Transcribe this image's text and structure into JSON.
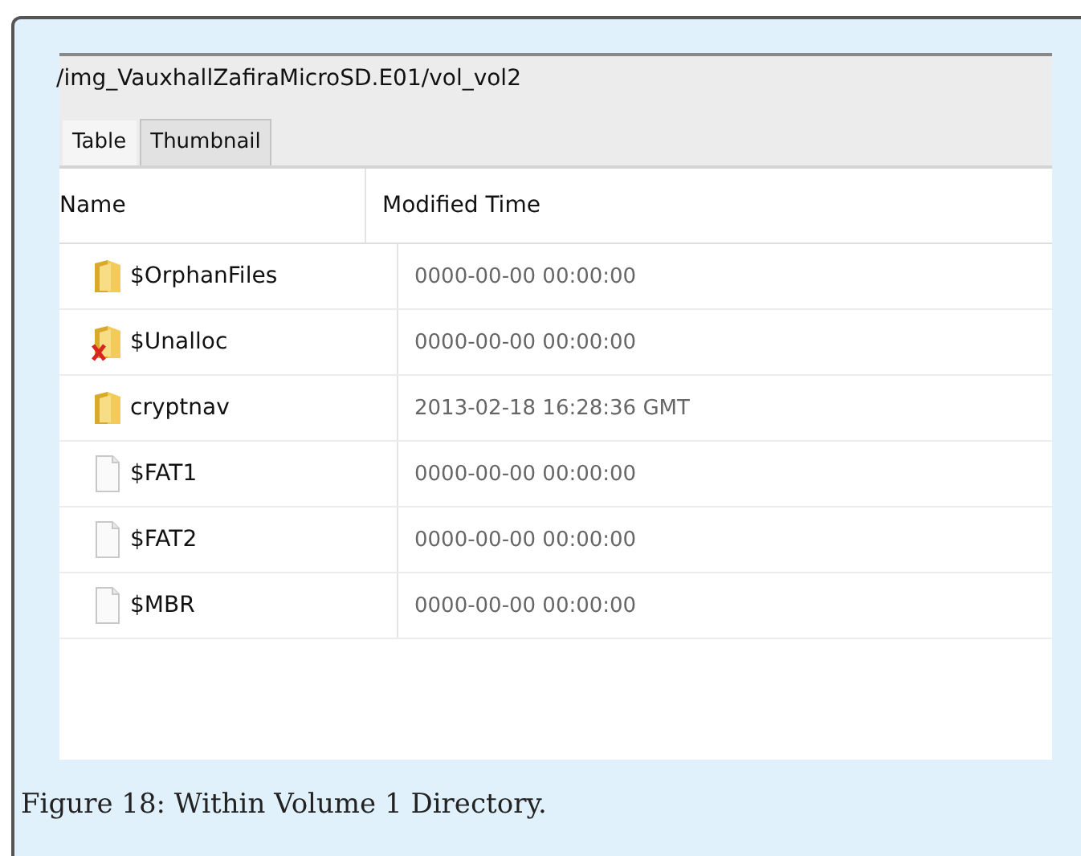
{
  "window": {
    "path": "/img_VauxhallZafiraMicroSD.E01/vol_vol2"
  },
  "tabs": [
    {
      "label": "Table",
      "selected": true
    },
    {
      "label": "Thumbnail",
      "selected": false
    }
  ],
  "table": {
    "columns": [
      "Name",
      "Modified Time"
    ],
    "rows": [
      {
        "kind": "folder",
        "name": "$OrphanFiles",
        "modified": "0000-00-00 00:00:00"
      },
      {
        "kind": "deleted-folder",
        "name": "$Unalloc",
        "modified": "0000-00-00 00:00:00"
      },
      {
        "kind": "folder",
        "name": "cryptnav",
        "modified": "2013-02-18 16:28:36 GMT"
      },
      {
        "kind": "file",
        "name": "$FAT1",
        "modified": "0000-00-00 00:00:00"
      },
      {
        "kind": "file",
        "name": "$FAT2",
        "modified": "0000-00-00 00:00:00"
      },
      {
        "kind": "file",
        "name": "$MBR",
        "modified": "0000-00-00 00:00:00"
      }
    ]
  },
  "caption": "Figure 18: Within Volume 1 Directory."
}
